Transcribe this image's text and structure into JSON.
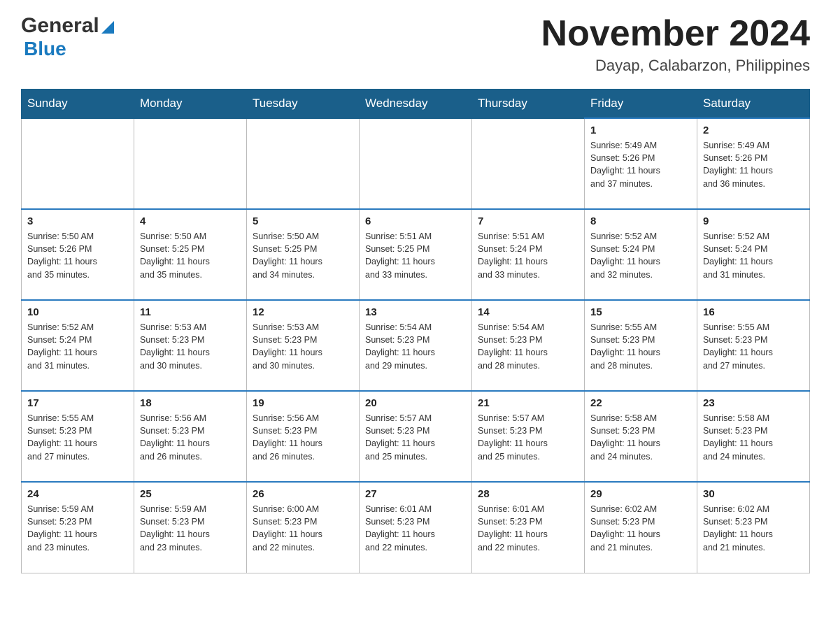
{
  "header": {
    "logo_general": "General",
    "logo_blue": "Blue",
    "month_title": "November 2024",
    "location": "Dayap, Calabarzon, Philippines"
  },
  "weekdays": [
    "Sunday",
    "Monday",
    "Tuesday",
    "Wednesday",
    "Thursday",
    "Friday",
    "Saturday"
  ],
  "weeks": [
    [
      {
        "day": "",
        "info": ""
      },
      {
        "day": "",
        "info": ""
      },
      {
        "day": "",
        "info": ""
      },
      {
        "day": "",
        "info": ""
      },
      {
        "day": "",
        "info": ""
      },
      {
        "day": "1",
        "info": "Sunrise: 5:49 AM\nSunset: 5:26 PM\nDaylight: 11 hours\nand 37 minutes."
      },
      {
        "day": "2",
        "info": "Sunrise: 5:49 AM\nSunset: 5:26 PM\nDaylight: 11 hours\nand 36 minutes."
      }
    ],
    [
      {
        "day": "3",
        "info": "Sunrise: 5:50 AM\nSunset: 5:26 PM\nDaylight: 11 hours\nand 35 minutes."
      },
      {
        "day": "4",
        "info": "Sunrise: 5:50 AM\nSunset: 5:25 PM\nDaylight: 11 hours\nand 35 minutes."
      },
      {
        "day": "5",
        "info": "Sunrise: 5:50 AM\nSunset: 5:25 PM\nDaylight: 11 hours\nand 34 minutes."
      },
      {
        "day": "6",
        "info": "Sunrise: 5:51 AM\nSunset: 5:25 PM\nDaylight: 11 hours\nand 33 minutes."
      },
      {
        "day": "7",
        "info": "Sunrise: 5:51 AM\nSunset: 5:24 PM\nDaylight: 11 hours\nand 33 minutes."
      },
      {
        "day": "8",
        "info": "Sunrise: 5:52 AM\nSunset: 5:24 PM\nDaylight: 11 hours\nand 32 minutes."
      },
      {
        "day": "9",
        "info": "Sunrise: 5:52 AM\nSunset: 5:24 PM\nDaylight: 11 hours\nand 31 minutes."
      }
    ],
    [
      {
        "day": "10",
        "info": "Sunrise: 5:52 AM\nSunset: 5:24 PM\nDaylight: 11 hours\nand 31 minutes."
      },
      {
        "day": "11",
        "info": "Sunrise: 5:53 AM\nSunset: 5:23 PM\nDaylight: 11 hours\nand 30 minutes."
      },
      {
        "day": "12",
        "info": "Sunrise: 5:53 AM\nSunset: 5:23 PM\nDaylight: 11 hours\nand 30 minutes."
      },
      {
        "day": "13",
        "info": "Sunrise: 5:54 AM\nSunset: 5:23 PM\nDaylight: 11 hours\nand 29 minutes."
      },
      {
        "day": "14",
        "info": "Sunrise: 5:54 AM\nSunset: 5:23 PM\nDaylight: 11 hours\nand 28 minutes."
      },
      {
        "day": "15",
        "info": "Sunrise: 5:55 AM\nSunset: 5:23 PM\nDaylight: 11 hours\nand 28 minutes."
      },
      {
        "day": "16",
        "info": "Sunrise: 5:55 AM\nSunset: 5:23 PM\nDaylight: 11 hours\nand 27 minutes."
      }
    ],
    [
      {
        "day": "17",
        "info": "Sunrise: 5:55 AM\nSunset: 5:23 PM\nDaylight: 11 hours\nand 27 minutes."
      },
      {
        "day": "18",
        "info": "Sunrise: 5:56 AM\nSunset: 5:23 PM\nDaylight: 11 hours\nand 26 minutes."
      },
      {
        "day": "19",
        "info": "Sunrise: 5:56 AM\nSunset: 5:23 PM\nDaylight: 11 hours\nand 26 minutes."
      },
      {
        "day": "20",
        "info": "Sunrise: 5:57 AM\nSunset: 5:23 PM\nDaylight: 11 hours\nand 25 minutes."
      },
      {
        "day": "21",
        "info": "Sunrise: 5:57 AM\nSunset: 5:23 PM\nDaylight: 11 hours\nand 25 minutes."
      },
      {
        "day": "22",
        "info": "Sunrise: 5:58 AM\nSunset: 5:23 PM\nDaylight: 11 hours\nand 24 minutes."
      },
      {
        "day": "23",
        "info": "Sunrise: 5:58 AM\nSunset: 5:23 PM\nDaylight: 11 hours\nand 24 minutes."
      }
    ],
    [
      {
        "day": "24",
        "info": "Sunrise: 5:59 AM\nSunset: 5:23 PM\nDaylight: 11 hours\nand 23 minutes."
      },
      {
        "day": "25",
        "info": "Sunrise: 5:59 AM\nSunset: 5:23 PM\nDaylight: 11 hours\nand 23 minutes."
      },
      {
        "day": "26",
        "info": "Sunrise: 6:00 AM\nSunset: 5:23 PM\nDaylight: 11 hours\nand 22 minutes."
      },
      {
        "day": "27",
        "info": "Sunrise: 6:01 AM\nSunset: 5:23 PM\nDaylight: 11 hours\nand 22 minutes."
      },
      {
        "day": "28",
        "info": "Sunrise: 6:01 AM\nSunset: 5:23 PM\nDaylight: 11 hours\nand 22 minutes."
      },
      {
        "day": "29",
        "info": "Sunrise: 6:02 AM\nSunset: 5:23 PM\nDaylight: 11 hours\nand 21 minutes."
      },
      {
        "day": "30",
        "info": "Sunrise: 6:02 AM\nSunset: 5:23 PM\nDaylight: 11 hours\nand 21 minutes."
      }
    ]
  ]
}
